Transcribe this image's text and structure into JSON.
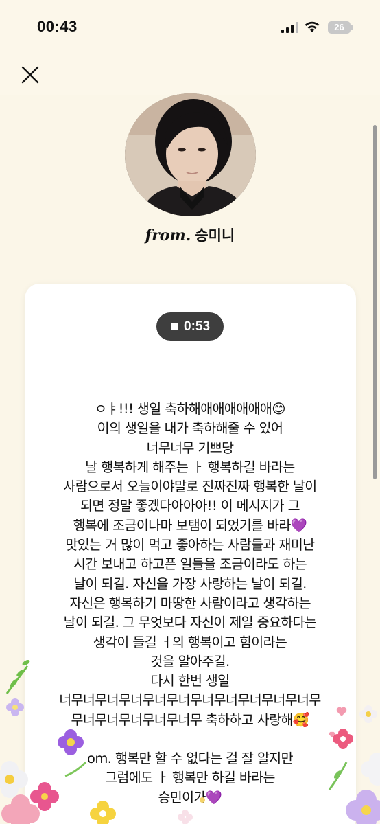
{
  "status_bar": {
    "time": "00:43",
    "battery": "26"
  },
  "sender": {
    "from_label": "from.",
    "name": "승미니"
  },
  "audio": {
    "duration": "0:53"
  },
  "message_lines": [
    "ㅇㅑ!!! 생일 축하해애애애애애애😊",
    "이의 생일을 내가 축하해줄 수 있어",
    "너무너무 기쁘당",
    "날 행복하게 해주는 ㅏ 행복하길 바라는",
    "사람으로서 오늘이야말로 진짜진짜 행복한 날이",
    "되면 정말 좋겠다아아아!! 이 메시지가 그",
    "행복에 조금이나마 보탬이 되었기를 바라💜",
    "맛있는 거 많이 먹고 좋아하는 사람들과 재미난",
    "시간 보내고 하고픈 일들을 조금이라도 하는",
    "날이 되길. 자신을 가장 사랑하는 날이 되길.",
    "자신은 행복하기 마땅한 사람이라고 생각하는",
    "날이 되길. 그 무엇보다 자신이 제일 중요하다는",
    "생각이 들길 ㅓ의 행복이고 힘이라는",
    "것을 알아주길.",
    "다시 한번 생일",
    "너무너무너무너무너무너무너무너무너무너무너무",
    "무너무너무너무너무너무 축하하고 사랑해🥰",
    "",
    "om. 행복만 할 수 없다는 걸 잘 알지만",
    "그럼에도 ㅏ 행복만 하길 바라는",
    "승민이가💜"
  ],
  "colors": {
    "background": "#fbf6e8",
    "card": "#ffffff",
    "audio_pill": "#3e3e3e"
  },
  "icons": [
    "close-icon",
    "stop-icon",
    "signal-icon",
    "wifi-icon",
    "battery-icon"
  ]
}
